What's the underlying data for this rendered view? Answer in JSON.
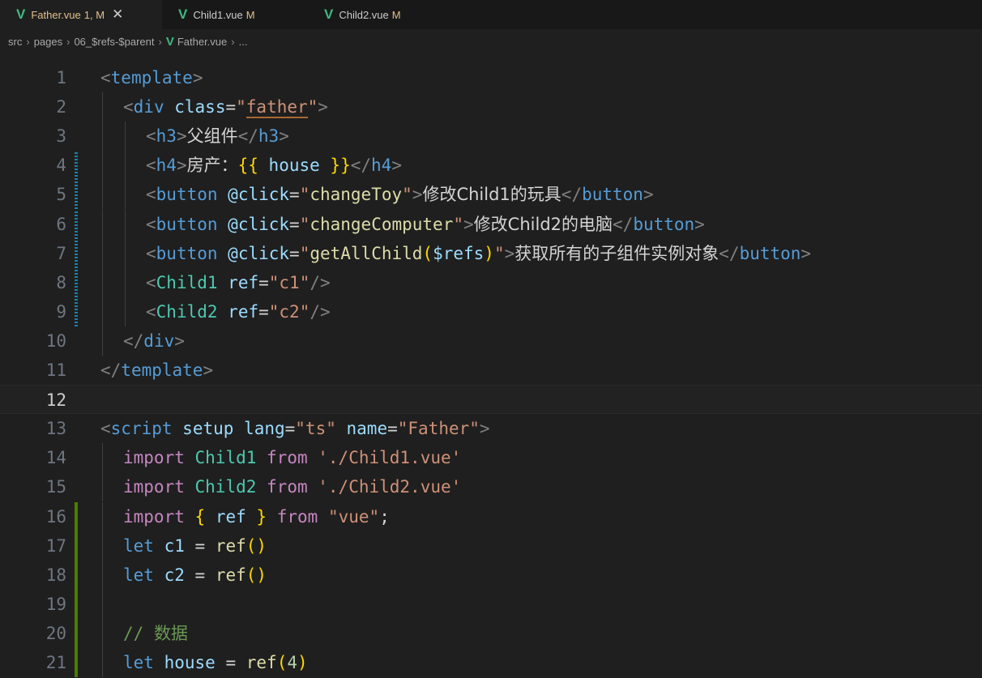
{
  "tabs": [
    {
      "name": "Father.vue",
      "status": "1, M",
      "close": "✕",
      "name_color": "#e2c08d",
      "status_color": "#e2c08d",
      "active": true
    },
    {
      "name": "Child1.vue",
      "status": "M",
      "name_color": "#cccccc",
      "status_color": "#e2c08d",
      "active": false
    },
    {
      "name": "Child2.vue",
      "status": "M",
      "name_color": "#cccccc",
      "status_color": "#e2c08d",
      "active": false
    }
  ],
  "breadcrumb": [
    "src",
    "pages",
    "06_$refs-$parent",
    "Father.vue",
    "..."
  ],
  "icons": {
    "vue_logo": "vue-logo-icon",
    "chevron": "chevron-right-icon",
    "close": "close-icon"
  },
  "colors": {
    "background": "#1f1f1f",
    "tag": "#808080",
    "tag_name": "#569cd6",
    "component_name": "#4ec9b0",
    "attribute": "#9cdcfe",
    "string": "#ce9178",
    "text": "#d4d4d4",
    "keyword": "#c586c0",
    "declaration": "#569cd6",
    "function": "#dcdcaa",
    "comment": "#6a9955",
    "number": "#b5cea8",
    "brace": "#ffd700",
    "bracket_purple": "#da70d6",
    "mustache": "#ffd700"
  },
  "lines": [
    {
      "n": "1",
      "indent": 0,
      "gutter": "",
      "tokens": [
        [
          "<",
          "tag"
        ],
        [
          "template",
          "tag_name"
        ],
        [
          ">",
          "tag"
        ]
      ]
    },
    {
      "n": "2",
      "indent": 1,
      "gutter": "",
      "tokens": [
        [
          "<",
          "tag"
        ],
        [
          "div",
          "tag_name"
        ],
        [
          " ",
          "text"
        ],
        [
          "class",
          "attribute"
        ],
        [
          "=",
          "text"
        ],
        [
          "\"",
          "string"
        ],
        [
          "father",
          "string_u"
        ],
        [
          "\"",
          "string"
        ],
        [
          ">",
          "tag"
        ]
      ]
    },
    {
      "n": "3",
      "indent": 2,
      "gutter": "",
      "tokens": [
        [
          "<",
          "tag"
        ],
        [
          "h3",
          "tag_name"
        ],
        [
          ">",
          "tag"
        ],
        [
          "父组件",
          "text_cjk"
        ],
        [
          "</",
          "tag"
        ],
        [
          "h3",
          "tag_name"
        ],
        [
          ">",
          "tag"
        ]
      ]
    },
    {
      "n": "4",
      "indent": 2,
      "gutter": "modified",
      "tokens": [
        [
          "<",
          "tag"
        ],
        [
          "h4",
          "tag_name"
        ],
        [
          ">",
          "tag"
        ],
        [
          "房产：",
          "text_cjk"
        ],
        [
          "{{",
          "mustache"
        ],
        [
          " house ",
          "attribute"
        ],
        [
          "}}",
          "mustache"
        ],
        [
          "</",
          "tag"
        ],
        [
          "h4",
          "tag_name"
        ],
        [
          ">",
          "tag"
        ]
      ]
    },
    {
      "n": "5",
      "indent": 2,
      "gutter": "modified",
      "tokens": [
        [
          "<",
          "tag"
        ],
        [
          "button",
          "tag_name"
        ],
        [
          " ",
          "text"
        ],
        [
          "@click",
          "attribute"
        ],
        [
          "=",
          "text"
        ],
        [
          "\"",
          "string"
        ],
        [
          "changeToy",
          "function"
        ],
        [
          "\"",
          "string"
        ],
        [
          ">",
          "tag"
        ],
        [
          "修改Child1的玩具",
          "text_cjk"
        ],
        [
          "</",
          "tag"
        ],
        [
          "button",
          "tag_name"
        ],
        [
          ">",
          "tag"
        ]
      ]
    },
    {
      "n": "6",
      "indent": 2,
      "gutter": "modified",
      "tokens": [
        [
          "<",
          "tag"
        ],
        [
          "button",
          "tag_name"
        ],
        [
          " ",
          "text"
        ],
        [
          "@click",
          "attribute"
        ],
        [
          "=",
          "text"
        ],
        [
          "\"",
          "string"
        ],
        [
          "changeComputer",
          "function"
        ],
        [
          "\"",
          "string"
        ],
        [
          ">",
          "tag"
        ],
        [
          "修改Child2的电脑",
          "text_cjk"
        ],
        [
          "</",
          "tag"
        ],
        [
          "button",
          "tag_name"
        ],
        [
          ">",
          "tag"
        ]
      ]
    },
    {
      "n": "7",
      "indent": 2,
      "gutter": "modified",
      "tokens": [
        [
          "<",
          "tag"
        ],
        [
          "button",
          "tag_name"
        ],
        [
          " ",
          "text"
        ],
        [
          "@click",
          "attribute"
        ],
        [
          "=",
          "text"
        ],
        [
          "\"",
          "string"
        ],
        [
          "getAllChild",
          "function"
        ],
        [
          "(",
          "brace"
        ],
        [
          "$refs",
          "attribute"
        ],
        [
          ")",
          "brace"
        ],
        [
          "\"",
          "string"
        ],
        [
          ">",
          "tag"
        ],
        [
          "获取所有的子组件实例对象",
          "text_cjk"
        ],
        [
          "</",
          "tag"
        ],
        [
          "button",
          "tag_name"
        ],
        [
          ">",
          "tag"
        ]
      ]
    },
    {
      "n": "8",
      "indent": 2,
      "gutter": "modified",
      "tokens": [
        [
          "<",
          "tag"
        ],
        [
          "Child1",
          "component_name"
        ],
        [
          " ",
          "text"
        ],
        [
          "ref",
          "attribute"
        ],
        [
          "=",
          "text"
        ],
        [
          "\"c1\"",
          "string"
        ],
        [
          "/>",
          "tag"
        ]
      ]
    },
    {
      "n": "9",
      "indent": 2,
      "gutter": "modified",
      "tokens": [
        [
          "<",
          "tag"
        ],
        [
          "Child2",
          "component_name"
        ],
        [
          " ",
          "text"
        ],
        [
          "ref",
          "attribute"
        ],
        [
          "=",
          "text"
        ],
        [
          "\"c2\"",
          "string"
        ],
        [
          "/>",
          "tag"
        ]
      ]
    },
    {
      "n": "10",
      "indent": 1,
      "gutter": "",
      "tokens": [
        [
          "</",
          "tag"
        ],
        [
          "div",
          "tag_name"
        ],
        [
          ">",
          "tag"
        ]
      ]
    },
    {
      "n": "11",
      "indent": 0,
      "gutter": "",
      "tokens": [
        [
          "</",
          "tag"
        ],
        [
          "template",
          "tag_name"
        ],
        [
          ">",
          "tag"
        ]
      ]
    },
    {
      "n": "12",
      "indent": 0,
      "gutter": "",
      "current": true,
      "tokens": []
    },
    {
      "n": "13",
      "indent": 0,
      "gutter": "",
      "tokens": [
        [
          "<",
          "tag"
        ],
        [
          "script",
          "tag_name"
        ],
        [
          " ",
          "text"
        ],
        [
          "setup",
          "attribute"
        ],
        [
          " ",
          "text"
        ],
        [
          "lang",
          "attribute"
        ],
        [
          "=",
          "text"
        ],
        [
          "\"ts\"",
          "string"
        ],
        [
          " ",
          "text"
        ],
        [
          "name",
          "attribute"
        ],
        [
          "=",
          "text"
        ],
        [
          "\"Father\"",
          "string"
        ],
        [
          ">",
          "tag"
        ]
      ]
    },
    {
      "n": "14",
      "indent": 1,
      "gutter": "",
      "tokens": [
        [
          "import",
          "keyword"
        ],
        [
          " ",
          "text"
        ],
        [
          "Child1",
          "component_name"
        ],
        [
          " ",
          "text"
        ],
        [
          "from",
          "keyword"
        ],
        [
          " ",
          "text"
        ],
        [
          "'./Child1.vue'",
          "string"
        ]
      ]
    },
    {
      "n": "15",
      "indent": 1,
      "gutter": "",
      "tokens": [
        [
          "import",
          "keyword"
        ],
        [
          " ",
          "text"
        ],
        [
          "Child2",
          "component_name"
        ],
        [
          " ",
          "text"
        ],
        [
          "from",
          "keyword"
        ],
        [
          " ",
          "text"
        ],
        [
          "'./Child2.vue'",
          "string"
        ]
      ]
    },
    {
      "n": "16",
      "indent": 1,
      "gutter": "added",
      "tokens": [
        [
          "import",
          "keyword"
        ],
        [
          " ",
          "text"
        ],
        [
          "{",
          "brace"
        ],
        [
          " ",
          "text"
        ],
        [
          "ref",
          "attribute"
        ],
        [
          " ",
          "text"
        ],
        [
          "}",
          "brace"
        ],
        [
          " ",
          "text"
        ],
        [
          "from",
          "keyword"
        ],
        [
          " ",
          "text"
        ],
        [
          "\"vue\"",
          "string"
        ],
        [
          ";",
          "text"
        ]
      ]
    },
    {
      "n": "17",
      "indent": 1,
      "gutter": "added",
      "tokens": [
        [
          "let",
          "declaration"
        ],
        [
          " ",
          "text"
        ],
        [
          "c1",
          "attribute"
        ],
        [
          " = ",
          "text"
        ],
        [
          "ref",
          "function"
        ],
        [
          "()",
          "brace"
        ]
      ]
    },
    {
      "n": "18",
      "indent": 1,
      "gutter": "added",
      "tokens": [
        [
          "let",
          "declaration"
        ],
        [
          " ",
          "text"
        ],
        [
          "c2",
          "attribute"
        ],
        [
          " = ",
          "text"
        ],
        [
          "ref",
          "function"
        ],
        [
          "()",
          "brace"
        ]
      ]
    },
    {
      "n": "19",
      "indent": 1,
      "gutter": "added",
      "tokens": []
    },
    {
      "n": "20",
      "indent": 1,
      "gutter": "added",
      "tokens": [
        [
          "// ",
          "comment"
        ],
        [
          "数据",
          "comment_cjk"
        ]
      ]
    },
    {
      "n": "21",
      "indent": 1,
      "gutter": "added",
      "tokens": [
        [
          "let",
          "declaration"
        ],
        [
          " ",
          "text"
        ],
        [
          "house",
          "attribute"
        ],
        [
          " = ",
          "text"
        ],
        [
          "ref",
          "function"
        ],
        [
          "(",
          "brace"
        ],
        [
          "4",
          "number"
        ],
        [
          ")",
          "brace"
        ]
      ]
    }
  ]
}
